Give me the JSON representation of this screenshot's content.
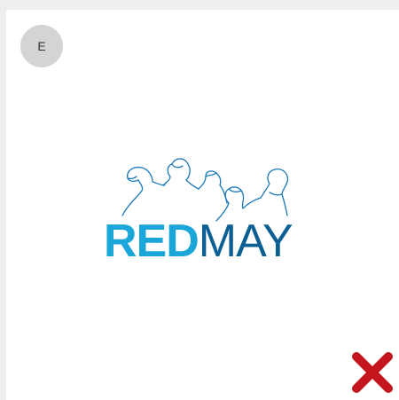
{
  "option": {
    "letter": "E"
  },
  "logo": {
    "part1": "RED",
    "part2": "MAY",
    "color_part1": "#1aa6d8",
    "color_part2": "#0b5f93",
    "line_color": "#1a79b8"
  },
  "feedback": {
    "icon": "cross-icon",
    "color": "#c4161c"
  }
}
